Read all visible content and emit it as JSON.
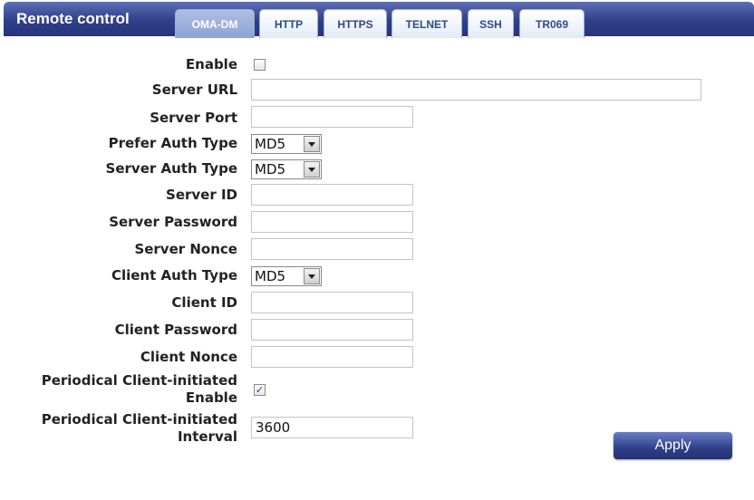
{
  "header": {
    "title": "Remote control"
  },
  "tabs": [
    {
      "label": "OMA-DM",
      "active": true
    },
    {
      "label": "HTTP",
      "active": false
    },
    {
      "label": "HTTPS",
      "active": false
    },
    {
      "label": "TELNET",
      "active": false
    },
    {
      "label": "SSH",
      "active": false
    },
    {
      "label": "TR069",
      "active": false
    }
  ],
  "form": {
    "enable": {
      "label": "Enable",
      "checked": false
    },
    "server_url": {
      "label": "Server URL",
      "value": ""
    },
    "server_port": {
      "label": "Server Port",
      "value": ""
    },
    "prefer_auth_type": {
      "label": "Prefer Auth Type",
      "value": "MD5"
    },
    "server_auth_type": {
      "label": "Server Auth Type",
      "value": "MD5"
    },
    "server_id": {
      "label": "Server ID",
      "value": ""
    },
    "server_password": {
      "label": "Server Password",
      "value": ""
    },
    "server_nonce": {
      "label": "Server Nonce",
      "value": ""
    },
    "client_auth_type": {
      "label": "Client Auth Type",
      "value": "MD5"
    },
    "client_id": {
      "label": "Client ID",
      "value": ""
    },
    "client_password": {
      "label": "Client Password",
      "value": ""
    },
    "client_nonce": {
      "label": "Client Nonce",
      "value": ""
    },
    "periodical_enable": {
      "label_line1": "Periodical Client-initiated",
      "label_line2": "Enable",
      "checked": true
    },
    "periodical_interval": {
      "label_line1": "Periodical Client-initiated",
      "label_line2": "Interval",
      "value": "3600"
    }
  },
  "apply_label": "Apply"
}
